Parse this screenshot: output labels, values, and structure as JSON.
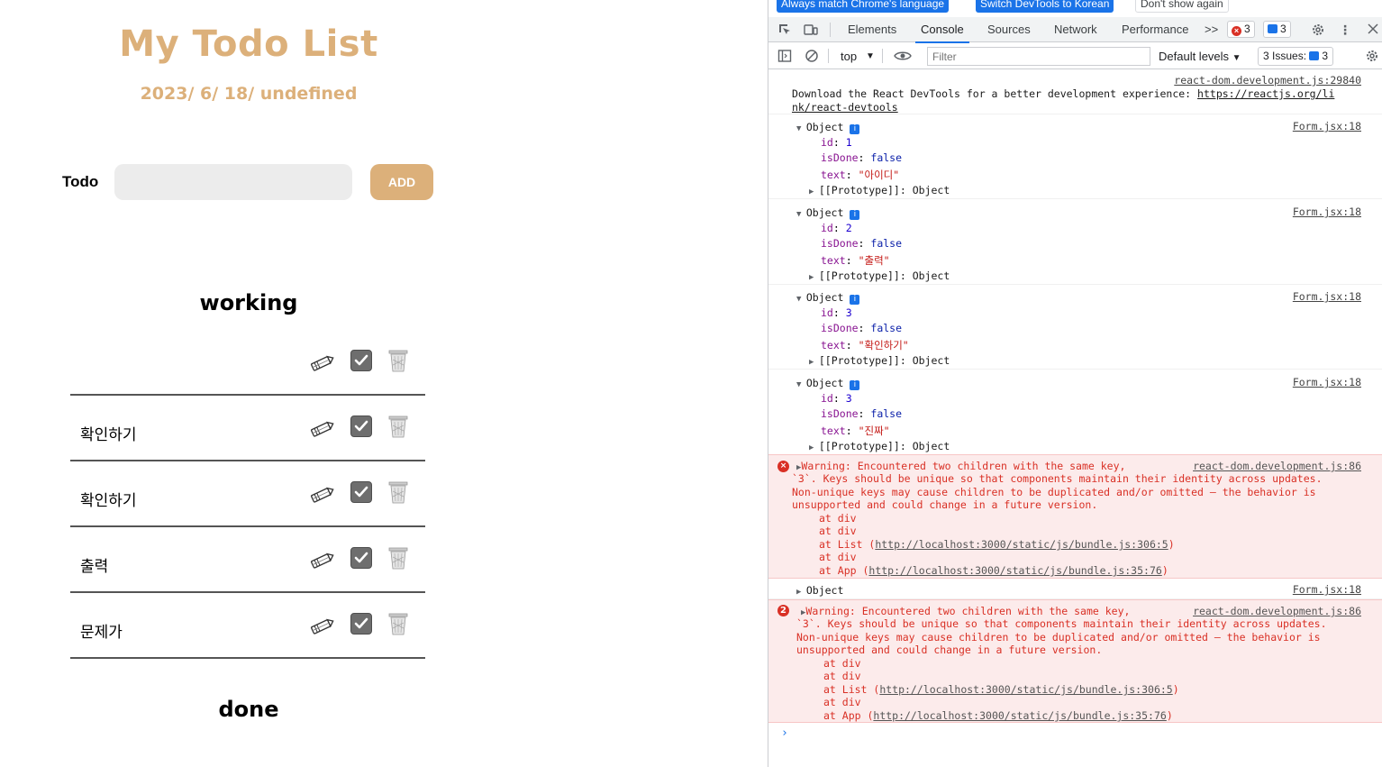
{
  "app": {
    "title": "My Todo List",
    "date": "2023/ 6/ 18/ undefined",
    "input_label": "Todo",
    "input_value": "",
    "add_label": "ADD",
    "working_title": "working",
    "done_title": "done",
    "todos": [
      "",
      "확인하기",
      "확인하기",
      "출력",
      "문제가"
    ]
  },
  "devtools": {
    "infobar": {
      "match_language": "Always match Chrome's language",
      "switch_korean": "Switch DevTools to Korean",
      "dont_show": "Don't show again"
    },
    "tabs": [
      "Elements",
      "Console",
      "Sources",
      "Network",
      "Performance"
    ],
    "more_tabs": ">>",
    "error_count": "3",
    "message_count": "3",
    "filterbar": {
      "context": "top",
      "filter_placeholder": "Filter",
      "levels": "Default levels",
      "issues_label": "3 Issues:",
      "issues_count": "3"
    },
    "console": {
      "devtools_src": "react-dom.development.js:29840",
      "devtools_msg": "Download the React DevTools for a better development experience: ",
      "devtools_link_1": "https://reactjs.org/li",
      "devtools_link_2": "nk/react-devtools",
      "object_src": "Form.jsx:18",
      "object_label": "Object",
      "info_badge": "i",
      "key_id": "id",
      "key_isdone": "isDone",
      "key_text": "text",
      "prototype": "[[Prototype]]: Object",
      "objects": [
        {
          "id": "1",
          "isDone": "false",
          "text": "\"아이디\""
        },
        {
          "id": "2",
          "isDone": "false",
          "text": "\"출력\""
        },
        {
          "id": "3",
          "isDone": "false",
          "text": "\"확인하기\""
        },
        {
          "id": "3",
          "isDone": "false",
          "text": "\"진짜\""
        }
      ],
      "warn_src": "react-dom.development.js:86",
      "warn_line1": "Warning: Encountered two children with the same key,",
      "warn_line2": "`3`. Keys should be unique so that components maintain their identity across updates.",
      "warn_line3": "Non-unique keys may cause children to be duplicated and/or omitted — the behavior is",
      "warn_line4": "unsupported and could change in a future version.",
      "stack_div": "at div",
      "stack_list": "at List (",
      "stack_list_url": "http://localhost:3000/static/js/bundle.js:306:5",
      "stack_app": "at App (",
      "stack_app_url": "http://localhost:3000/static/js/bundle.js:35:76",
      "close_paren": ")",
      "warn_repeat": "2",
      "collapsed_object": "Object",
      "prompt": "›"
    }
  }
}
